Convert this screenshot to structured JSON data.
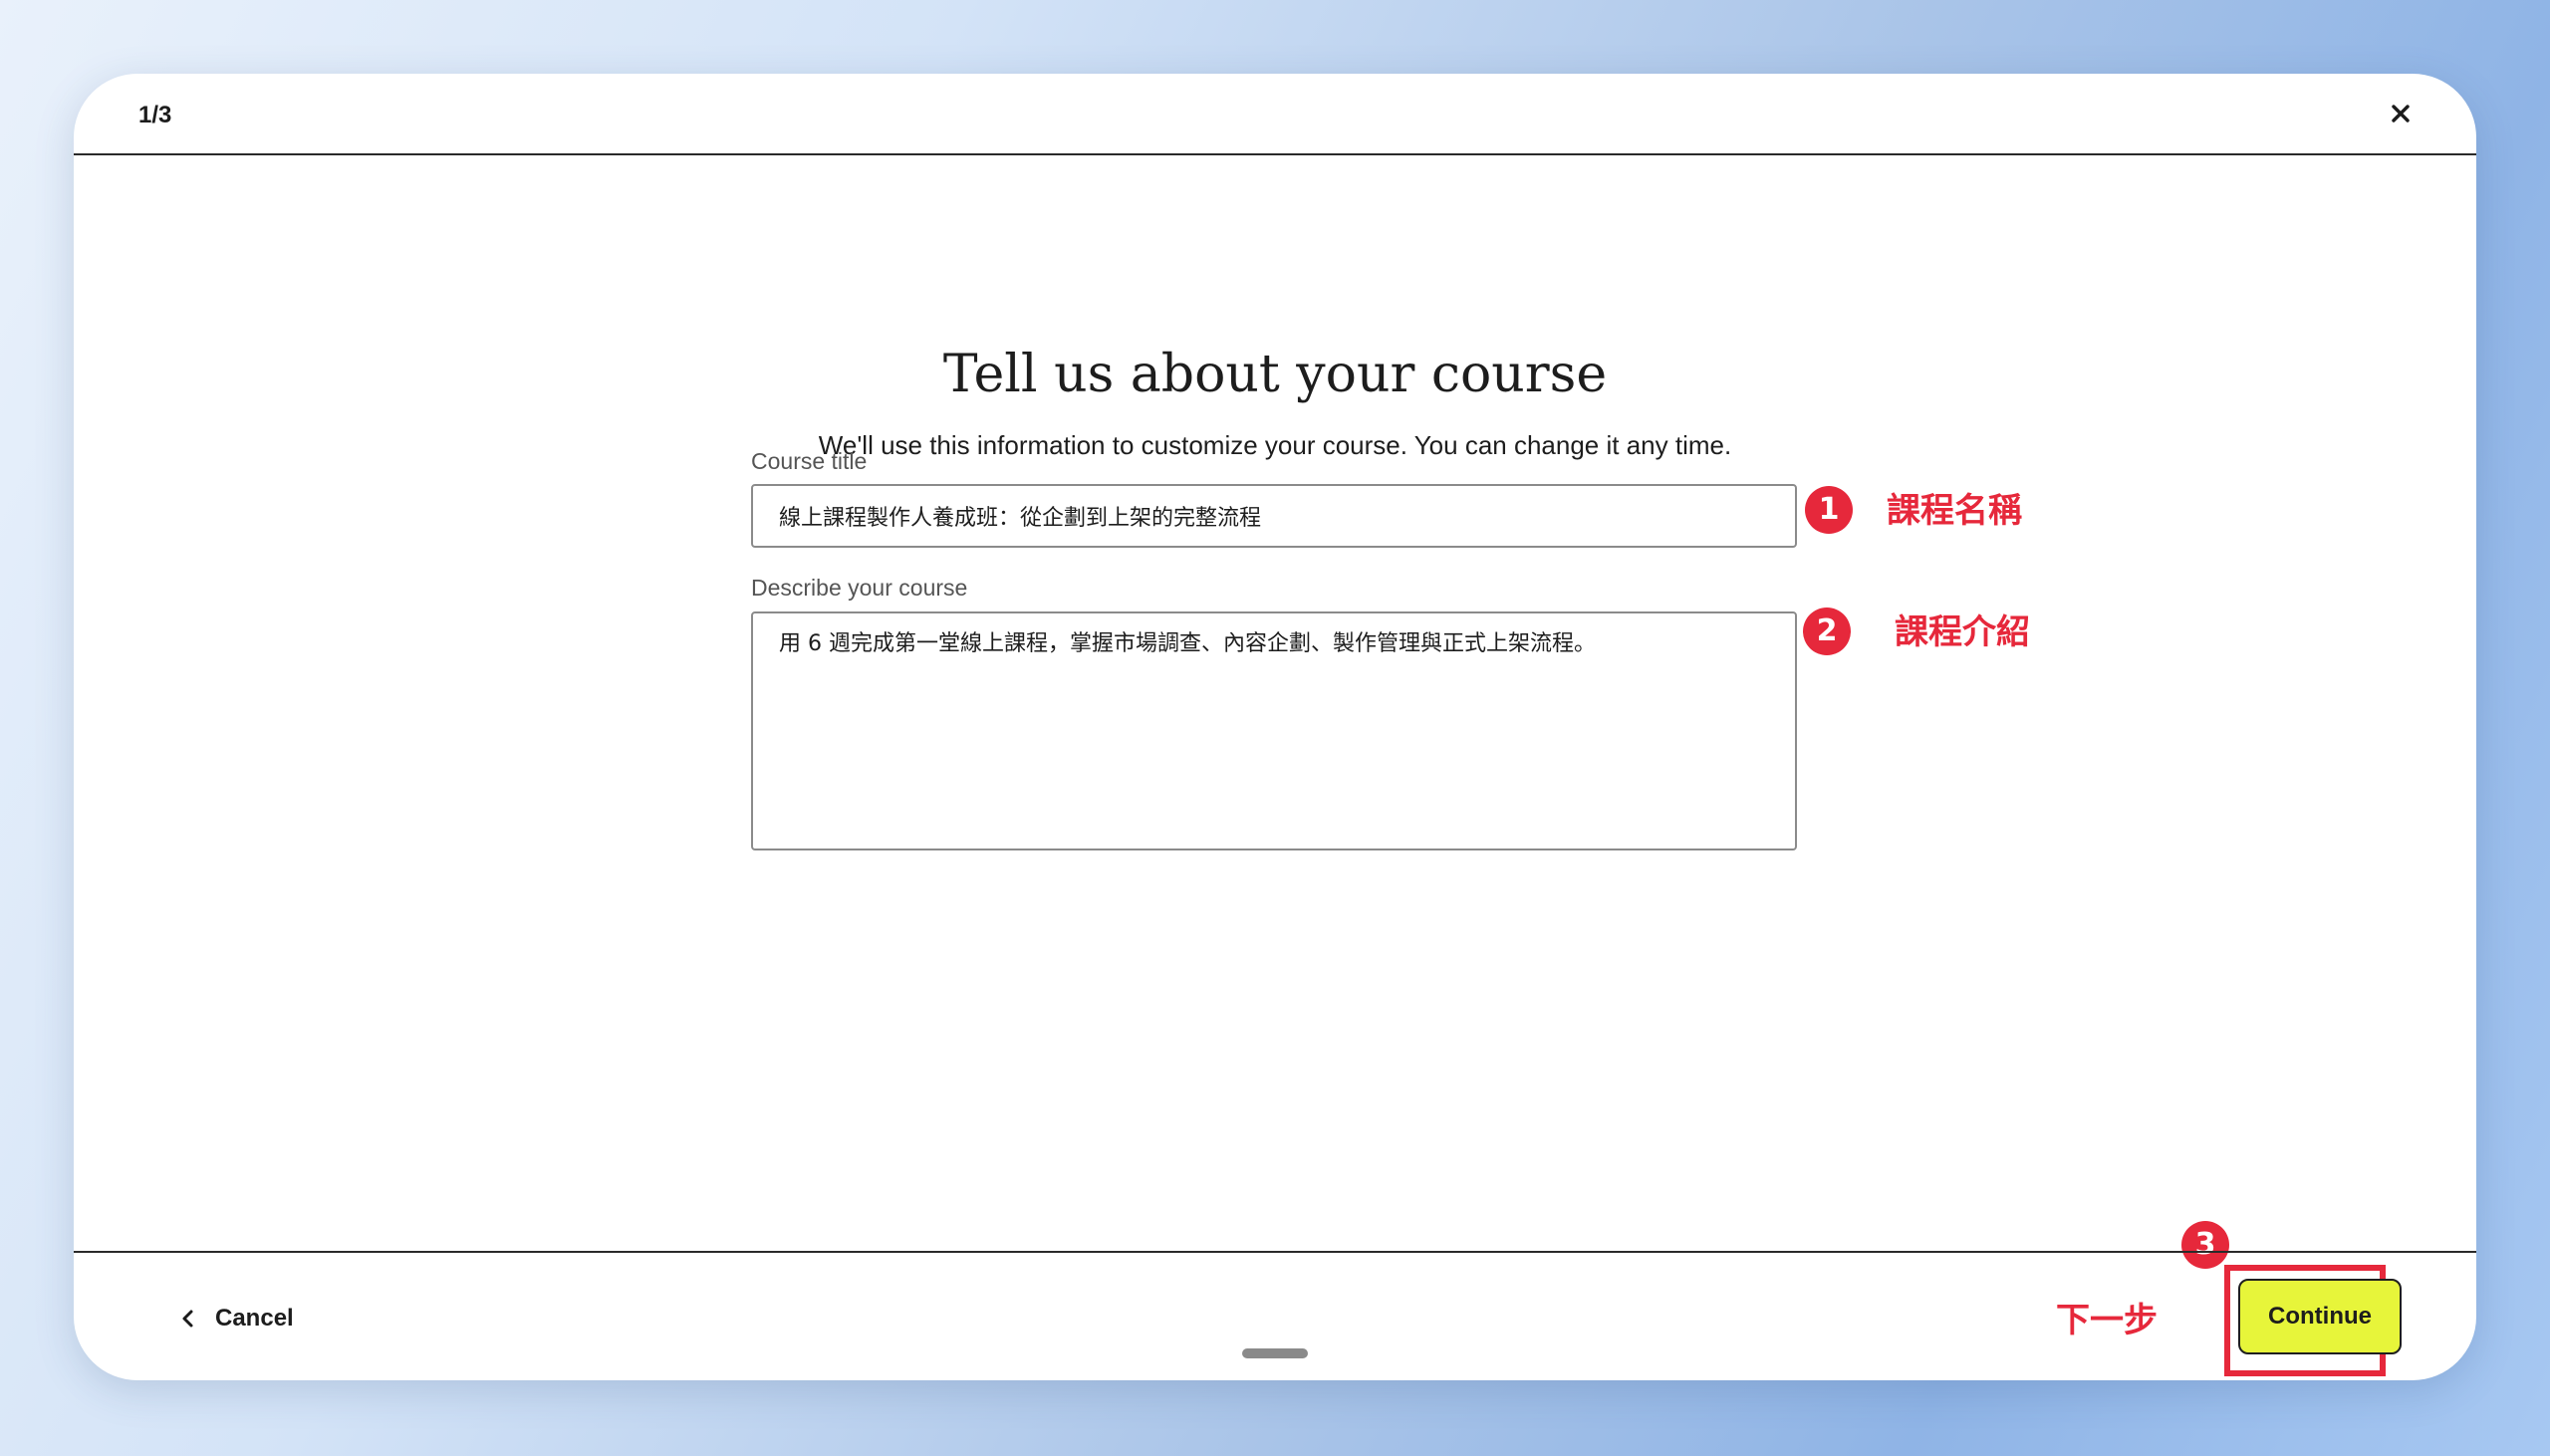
{
  "header": {
    "step": "1/3",
    "close_icon": "close-icon"
  },
  "main": {
    "title": "Tell us about your course",
    "subtitle": "We'll use this information to customize your course. You can change it any time.",
    "course_title": {
      "label": "Course title",
      "value": "線上課程製作人養成班：從企劃到上架的完整流程"
    },
    "description": {
      "label": "Describe your course",
      "value": "用 6 週完成第一堂線上課程，掌握市場調查、內容企劃、製作管理與正式上架流程。"
    }
  },
  "annotations": [
    {
      "number": "1",
      "text": "課程名稱"
    },
    {
      "number": "2",
      "text": "課程介紹"
    },
    {
      "number": "3",
      "text": "下一步"
    }
  ],
  "footer": {
    "cancel_label": "Cancel",
    "cancel_icon": "chevron-left-icon",
    "continue_label": "Continue"
  },
  "colors": {
    "accent": "#e7f53a",
    "annotation": "#e6283b"
  }
}
